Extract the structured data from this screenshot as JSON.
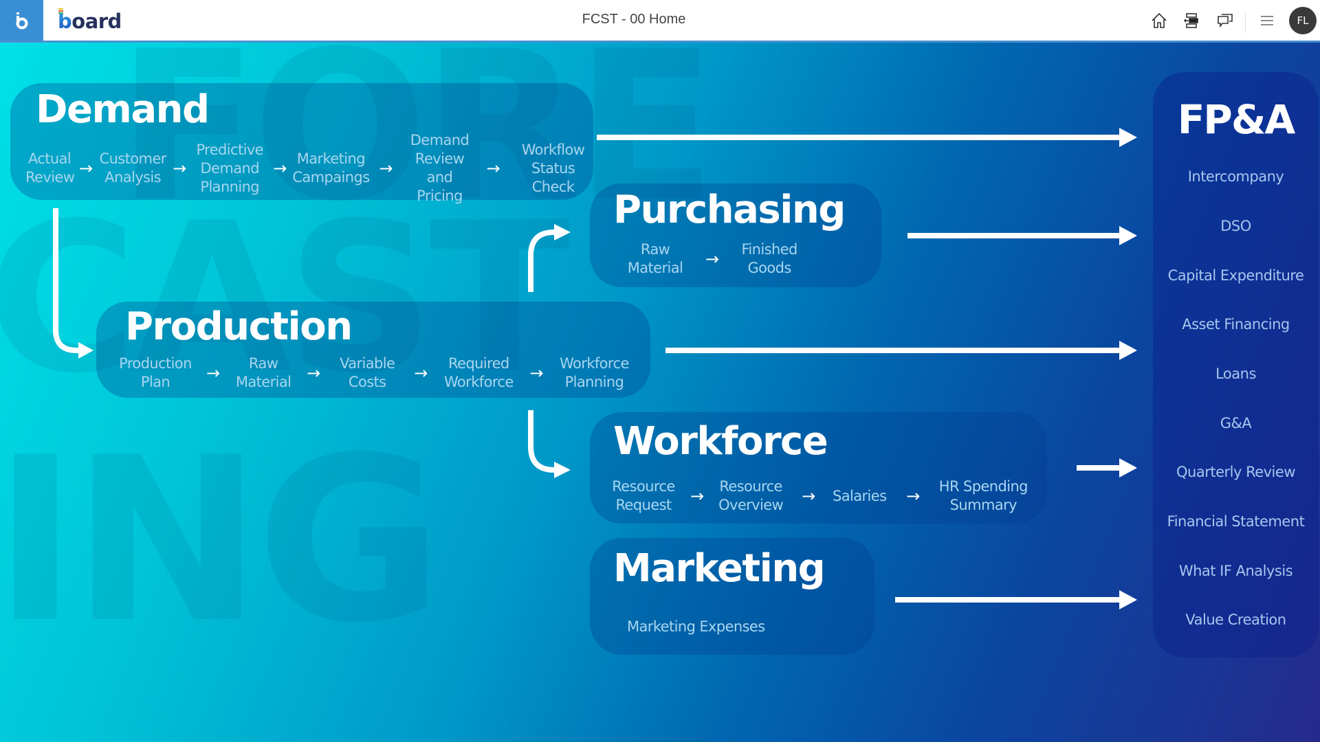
{
  "header": {
    "app_icon": "board-b-icon",
    "logo_text_b": "b",
    "logo_text_rest": "oard",
    "title": "FCST - 00 Home",
    "icons": [
      "home-icon",
      "layout-panel-icon",
      "chat-icon",
      "hamburger-menu-icon"
    ],
    "avatar_initials": "FL"
  },
  "background": {
    "watermark_lines": [
      "FORE",
      "CAST",
      "ING"
    ]
  },
  "colors": {
    "header_accent": "#3a8fd4",
    "gradient_start": "#00e0e8",
    "gradient_end": "#252a8c",
    "step_text": "#a8d6f0",
    "title_text": "#ffffff"
  },
  "sections": {
    "demand": {
      "title": "Demand",
      "steps": [
        "Actual\nReview",
        "Customer\nAnalysis",
        "Predictive\nDemand\nPlanning",
        "Marketing\nCampaings",
        "Demand\nReview\nand Pricing",
        "Workflow\nStatus Check"
      ]
    },
    "purchasing": {
      "title": "Purchasing",
      "steps": [
        "Raw\nMaterial",
        "Finished\nGoods"
      ]
    },
    "production": {
      "title": "Production",
      "steps": [
        "Production\nPlan",
        "Raw\nMaterial",
        "Variable\nCosts",
        "Required\nWorkforce",
        "Workforce\nPlanning"
      ]
    },
    "workforce": {
      "title": "Workforce",
      "steps": [
        "Resource\nRequest",
        "Resource\nOverview",
        "Salaries",
        "HR Spending\nSummary"
      ]
    },
    "marketing": {
      "title": "Marketing",
      "steps": [
        "Marketing Expenses"
      ]
    }
  },
  "step_arrow": "→",
  "fpa": {
    "title": "FP&A",
    "items": [
      "Intercompany",
      "DSO",
      "Capital Expenditure",
      "Asset Financing",
      "Loans",
      "G&A",
      "Quarterly Review",
      "Financial Statement",
      "What IF Analysis",
      "Value Creation"
    ]
  }
}
